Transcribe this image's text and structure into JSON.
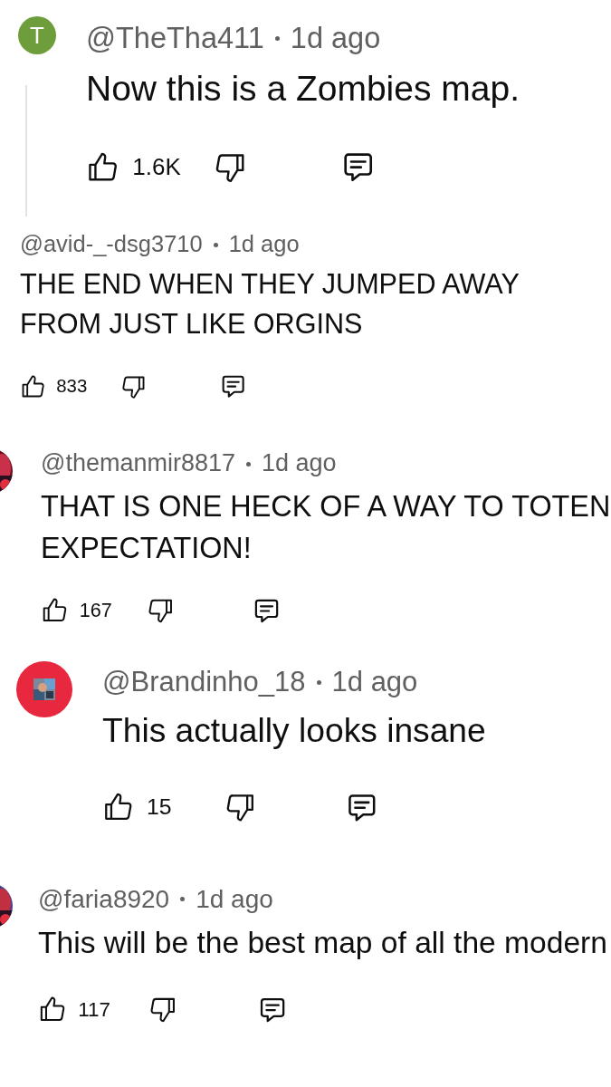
{
  "comments": [
    {
      "avatar": {
        "kind": "letter",
        "letter": "T",
        "color": "#6d9e3b"
      },
      "author": "@TheTha411",
      "time": "1d ago",
      "text": "Now this is a Zombies map.",
      "likes": "1.6K",
      "thread_line": true
    },
    {
      "avatar": {
        "kind": "none"
      },
      "author": "@avid-_-dsg3710",
      "time": "1d ago",
      "text": "THE END WHEN THEY JUMPED AWAY FROM JUST LIKE ORGINS",
      "likes": "833"
    },
    {
      "author": "@themanmir8817",
      "time": "1d ago",
      "text": "THAT IS ONE HECK OF A WAY TO TOTEN EXPECTATION!",
      "likes": "167"
    },
    {
      "avatar": {
        "kind": "framed-picture",
        "color": "#e8283f"
      },
      "author": "@Brandinho_18",
      "time": "1d ago",
      "text": "This actually looks insane",
      "likes": "15"
    },
    {
      "author": "@faria8920",
      "time": "1d ago",
      "text": "This will be the best map of all the modern",
      "likes": "117"
    }
  ]
}
